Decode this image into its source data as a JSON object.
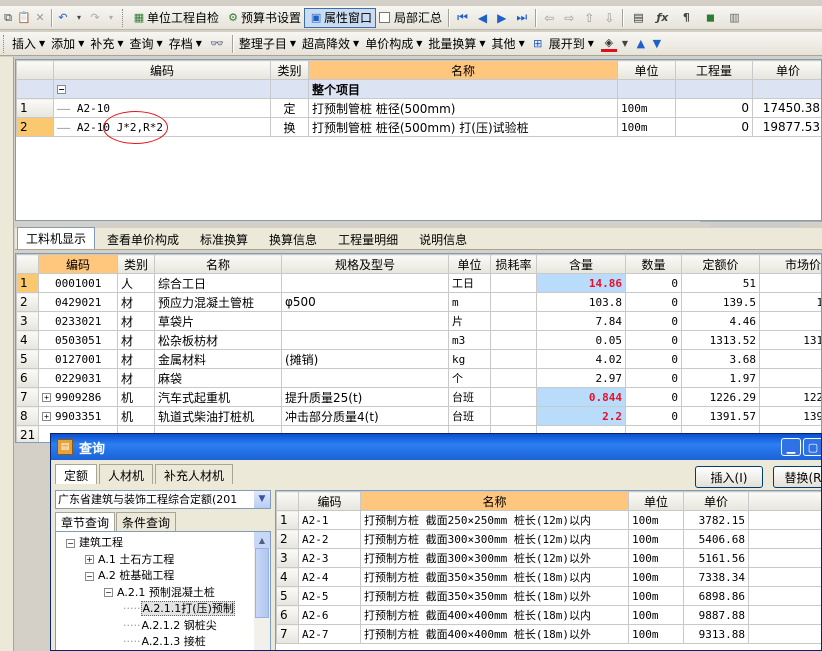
{
  "toolbar1": {
    "items": [
      "单位工程自检",
      "预算书设置",
      "属性窗口",
      "局部汇总"
    ]
  },
  "toolbar2": {
    "items": [
      {
        "label": "插入",
        "dropdown": true
      },
      {
        "label": "添加",
        "dropdown": true
      },
      {
        "label": "补充",
        "dropdown": true
      },
      {
        "label": "查询",
        "dropdown": true
      },
      {
        "label": "存档",
        "dropdown": true
      },
      {
        "label": "整理子目",
        "dropdown": true
      },
      {
        "label": "超高降效",
        "dropdown": true
      },
      {
        "label": "单价构成",
        "dropdown": true
      },
      {
        "label": "批量换算",
        "dropdown": true
      },
      {
        "label": "其他",
        "dropdown": true
      },
      {
        "label": "展开到",
        "dropdown": true
      }
    ]
  },
  "top_grid": {
    "headers": [
      "编码",
      "类别",
      "名称",
      "单位",
      "工程量",
      "单价"
    ],
    "group_row": {
      "label": "整个项目"
    },
    "rows": [
      {
        "num": "1",
        "code": "A2-10",
        "cat": "定",
        "name": "打预制管桩 桩径(500mm)",
        "unit": "100m",
        "qty": "0",
        "price": "17450.38"
      },
      {
        "num": "2",
        "code": "A2-10 J*2,R*2",
        "cat": "换",
        "name": "打预制管桩 桩径(500mm) 打(压)试验桩",
        "unit": "100m",
        "qty": "0",
        "price": "19877.53"
      }
    ]
  },
  "mid_tabs": [
    "工料机显示",
    "查看单价构成",
    "标准换算",
    "换算信息",
    "工程量明细",
    "说明信息"
  ],
  "material_grid": {
    "headers": [
      "编码",
      "类别",
      "名称",
      "规格及型号",
      "单位",
      "损耗率",
      "含量",
      "数量",
      "定额价",
      "市场价"
    ],
    "rows": [
      {
        "num": "1",
        "code": "0001001",
        "cat": "人",
        "name": "综合工日",
        "spec": "",
        "unit": "工日",
        "loss": "",
        "content": "14.86",
        "qty": "0",
        "quota": "51",
        "market": "5",
        "expand": false,
        "hl": true
      },
      {
        "num": "2",
        "code": "0429021",
        "cat": "材",
        "name": "预应力混凝土管桩",
        "spec": "φ500",
        "unit": "m",
        "loss": "",
        "content": "103.8",
        "qty": "0",
        "quota": "139.5",
        "market": "139.",
        "expand": false,
        "hl": false
      },
      {
        "num": "3",
        "code": "0233021",
        "cat": "材",
        "name": "草袋片",
        "spec": "",
        "unit": "片",
        "loss": "",
        "content": "7.84",
        "qty": "0",
        "quota": "4.46",
        "market": "4.4",
        "expand": false,
        "hl": false
      },
      {
        "num": "4",
        "code": "0503051",
        "cat": "材",
        "name": "松杂板枋材",
        "spec": "",
        "unit": "m3",
        "loss": "",
        "content": "0.05",
        "qty": "0",
        "quota": "1313.52",
        "market": "1313.5",
        "expand": false,
        "hl": false
      },
      {
        "num": "5",
        "code": "0127001",
        "cat": "材",
        "name": "金属材料",
        "spec": "(摊销)",
        "unit": "kg",
        "loss": "",
        "content": "4.02",
        "qty": "0",
        "quota": "3.68",
        "market": "3.6",
        "expand": false,
        "hl": false
      },
      {
        "num": "6",
        "code": "0229031",
        "cat": "材",
        "name": "麻袋",
        "spec": "",
        "unit": "个",
        "loss": "",
        "content": "2.97",
        "qty": "0",
        "quota": "1.97",
        "market": "1.9",
        "expand": false,
        "hl": false
      },
      {
        "num": "7",
        "code": "9909286",
        "cat": "机",
        "name": "汽车式起重机",
        "spec": "提升质量25(t)",
        "unit": "台班",
        "loss": "",
        "content": "0.844",
        "qty": "0",
        "quota": "1226.29",
        "market": "1226.2",
        "expand": true,
        "hl": true
      },
      {
        "num": "8",
        "code": "9903351",
        "cat": "机",
        "name": "轨道式柴油打桩机",
        "spec": "冲击部分质量4(t)",
        "unit": "台班",
        "loss": "",
        "content": "2.2",
        "qty": "0",
        "quota": "1391.57",
        "market": "1391.5",
        "expand": true,
        "hl": true
      },
      {
        "num": "21",
        "code": "",
        "cat": "",
        "name": "",
        "spec": "",
        "unit": "",
        "loss": "",
        "content": "",
        "qty": "",
        "quota": "",
        "market": "",
        "expand": false,
        "hl": false
      }
    ]
  },
  "dialog": {
    "title": "查询",
    "tabs": [
      "定额",
      "人材机",
      "补充人材机"
    ],
    "insert_button": "插入(I)",
    "replace_button": "替换(R",
    "library": "广东省建筑与装饰工程综合定额(201",
    "subtabs": [
      "章节查询",
      "条件查询"
    ],
    "tree": [
      {
        "label": "建筑工程",
        "level": 0,
        "box": "−"
      },
      {
        "label": "A.1 土石方工程",
        "level": 1,
        "box": "+"
      },
      {
        "label": "A.2 桩基础工程",
        "level": 1,
        "box": "−"
      },
      {
        "label": "A.2.1 预制混凝土桩",
        "level": 2,
        "box": "−"
      },
      {
        "label": "A.2.1.1打(压)预制",
        "level": 3,
        "box": "",
        "selected": true
      },
      {
        "label": "A.2.1.2 钢桩尖",
        "level": 3,
        "box": ""
      },
      {
        "label": "A.2.1.3 接桩",
        "level": 3,
        "box": ""
      }
    ],
    "grid": {
      "headers": [
        "编码",
        "名称",
        "单位",
        "单价"
      ],
      "rows": [
        {
          "num": "1",
          "code": "A2-1",
          "name": "打预制方桩 截面250×250mm 桩长(12m)以内",
          "unit": "100m",
          "price": "3782.15"
        },
        {
          "num": "2",
          "code": "A2-2",
          "name": "打预制方桩 截面300×300mm 桩长(12m)以内",
          "unit": "100m",
          "price": "5406.68"
        },
        {
          "num": "3",
          "code": "A2-3",
          "name": "打预制方桩 截面300×300mm 桩长(12m)以外",
          "unit": "100m",
          "price": "5161.56"
        },
        {
          "num": "4",
          "code": "A2-4",
          "name": "打预制方桩 截面350×350mm 桩长(18m)以内",
          "unit": "100m",
          "price": "7338.34"
        },
        {
          "num": "5",
          "code": "A2-5",
          "name": "打预制方桩 截面350×350mm 桩长(18m)以外",
          "unit": "100m",
          "price": "6898.86"
        },
        {
          "num": "6",
          "code": "A2-6",
          "name": "打预制方桩 截面400×400mm 桩长(18m)以内",
          "unit": "100m",
          "price": "9887.88"
        },
        {
          "num": "7",
          "code": "A2-7",
          "name": "打预制方桩 截面400×400mm 桩长(18m)以外",
          "unit": "100m",
          "price": "9313.88"
        }
      ]
    }
  },
  "colors": {
    "accent": "#ffc77d",
    "highlight": "#b9dcfa",
    "red": "#e8112d",
    "title_bar": "#0a4fd0"
  }
}
